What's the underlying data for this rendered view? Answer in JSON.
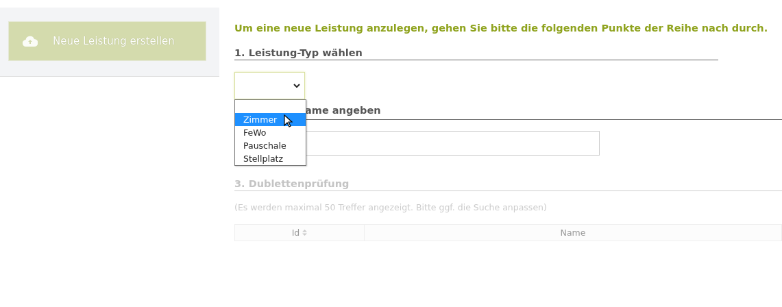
{
  "sidebar": {
    "create_button": {
      "label": "Neue Leistung erstellen",
      "disabled": true
    }
  },
  "intro": "Um eine neue Leistung anzulegen, gehen Sie bitte die folgenden Punkte der Reihe nach durch.",
  "step1": {
    "heading": "1. Leistung-Typ wählen",
    "select": {
      "expanded": true,
      "options": [
        {
          "selected": false
        },
        {
          "label": "Zimmer",
          "selected": true
        },
        {
          "label": "FeWo",
          "selected": false
        },
        {
          "label": "Pauschale",
          "selected": false
        },
        {
          "label": "Stellplatz",
          "selected": false
        }
      ]
    }
  },
  "step2": {
    "heading": "ame angeben"
  },
  "step3": {
    "heading": "3. Dublettenprüfung",
    "disabled": true,
    "note": "(Es werden maximal 50 Treffer angezeigt. Bitte ggf. die Suche anpassen)",
    "table": {
      "columns": [
        "Id",
        "Name"
      ]
    }
  }
}
